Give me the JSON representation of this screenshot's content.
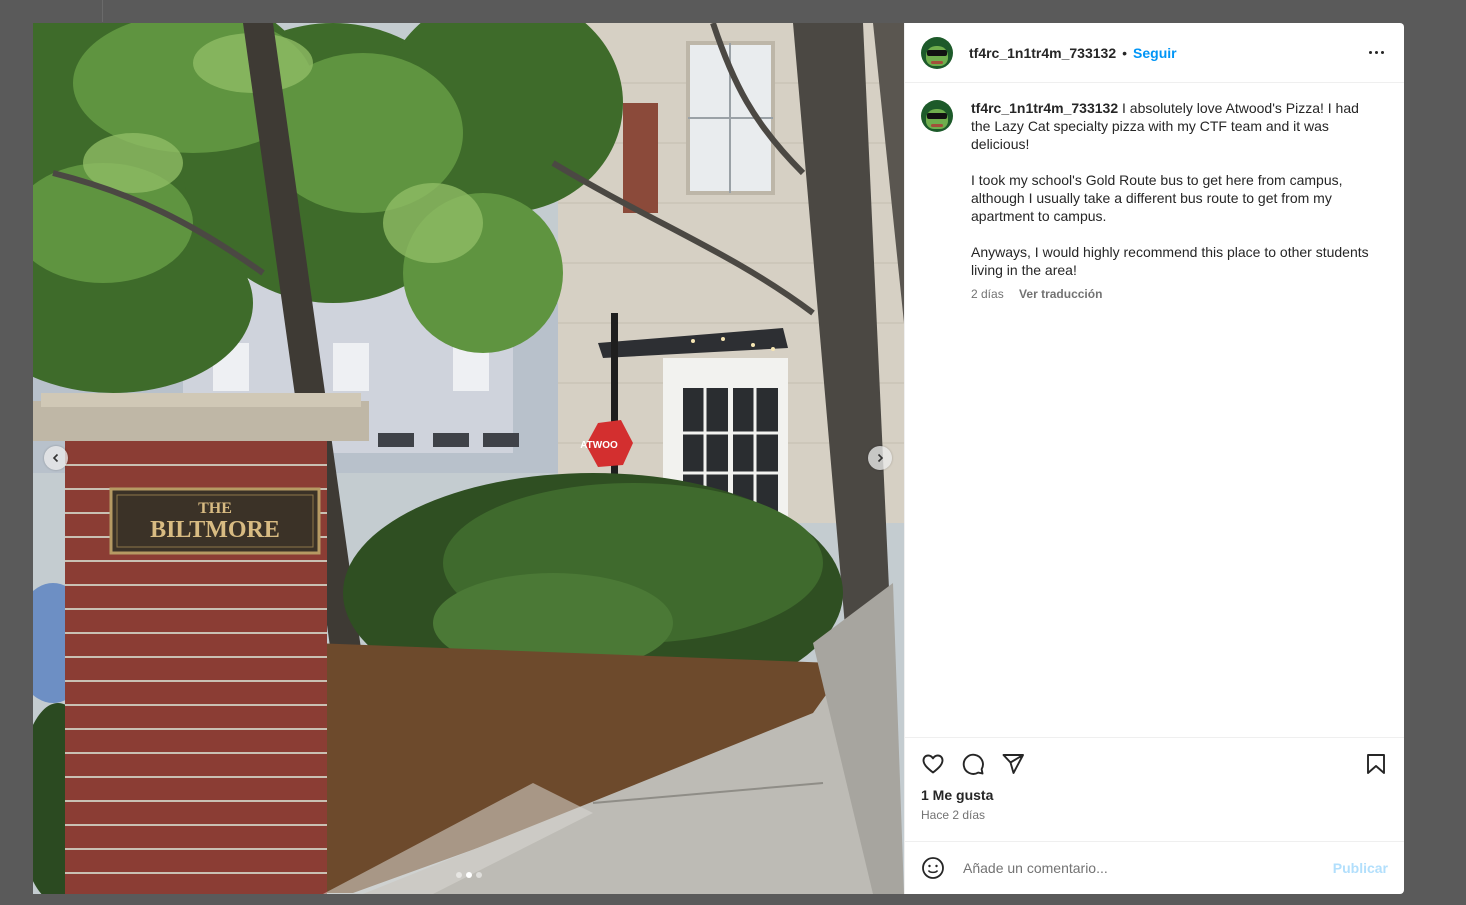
{
  "post": {
    "username": "tf4rc_1n1tr4m_733132",
    "separator": "•",
    "follow_label": "Seguir",
    "carousel": {
      "total": 3,
      "current": 2
    },
    "photo": {
      "sign_line1": "THE",
      "sign_line2": "BILTMORE",
      "storefront_sign": "ATWOO"
    },
    "caption": {
      "username": "tf4rc_1n1tr4m_733132",
      "text": " I absolutely love Atwood's Pizza! I had the Lazy Cat specialty pizza with my CTF team and it was delicious!\n\nI took my school's Gold Route bus to get here from campus, although I usually take a different bus route to get from my apartment to campus.\n\nAnyways, I would highly recommend this place to other students living in the area!",
      "age": "2 días",
      "translate_label": "Ver traducción"
    },
    "likes_label": "1 Me gusta",
    "posted_ago": "Hace 2 días",
    "comment_placeholder": "Añade un comentario...",
    "publish_label": "Publicar"
  },
  "icons": {
    "like": "heart-icon",
    "comment": "comment-icon",
    "share": "send-icon",
    "save": "bookmark-icon",
    "emoji": "emoji-icon",
    "more": "more-options-icon"
  },
  "colors": {
    "link": "#0095f6",
    "publish_disabled": "#b2dffc",
    "text": "#262626",
    "muted": "#737373"
  }
}
